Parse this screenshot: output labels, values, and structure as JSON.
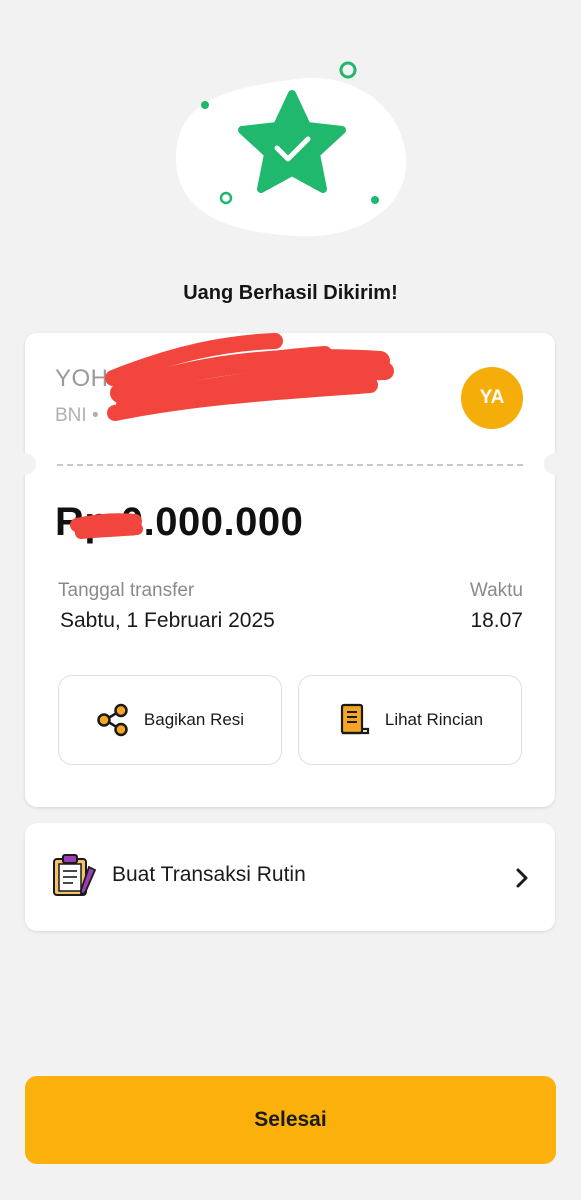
{
  "header": {
    "title": "Uang Berhasil Dikirim!"
  },
  "recipient": {
    "name": "YOH",
    "bank": "BNI •",
    "initials": "YA"
  },
  "transfer": {
    "amount": "Rp 0.000.000",
    "date_label": "Tanggal transfer",
    "date": "Sabtu, 1 Februari 2025",
    "time_label": "Waktu",
    "time": "18.07"
  },
  "actions": {
    "share_label": "Bagikan Resi",
    "details_label": "Lihat Rincian"
  },
  "routine": {
    "label": "Buat Transaksi Rutin"
  },
  "footer": {
    "done_label": "Selesai"
  },
  "colors": {
    "accent": "#fcb00c",
    "success": "#20b86c",
    "avatar": "#f5ad0a",
    "redaction": "#f2453d"
  }
}
